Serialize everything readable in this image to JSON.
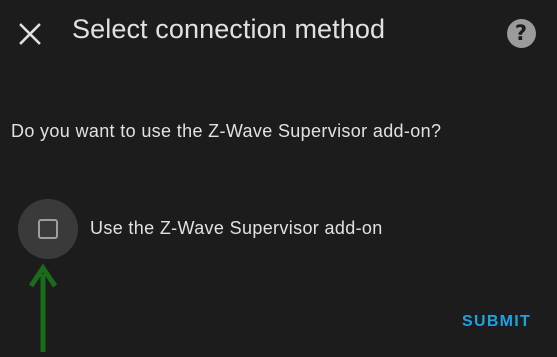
{
  "dialog": {
    "title": "Select connection method",
    "close_icon": "close-icon",
    "help_icon": "help-circle-icon",
    "help_glyph": "?",
    "question": "Do you want to use the Z-Wave Supervisor add-on?",
    "checkbox": {
      "label": "Use the Z-Wave Supervisor add-on",
      "checked": false
    },
    "submit_label": "SUBMIT"
  },
  "annotation": {
    "icon": "arrow-up-icon",
    "color": "#1a6b1a"
  },
  "colors": {
    "background": "#1c1c1c",
    "text": "#e1e1e1",
    "accent": "#1ea3e0"
  }
}
